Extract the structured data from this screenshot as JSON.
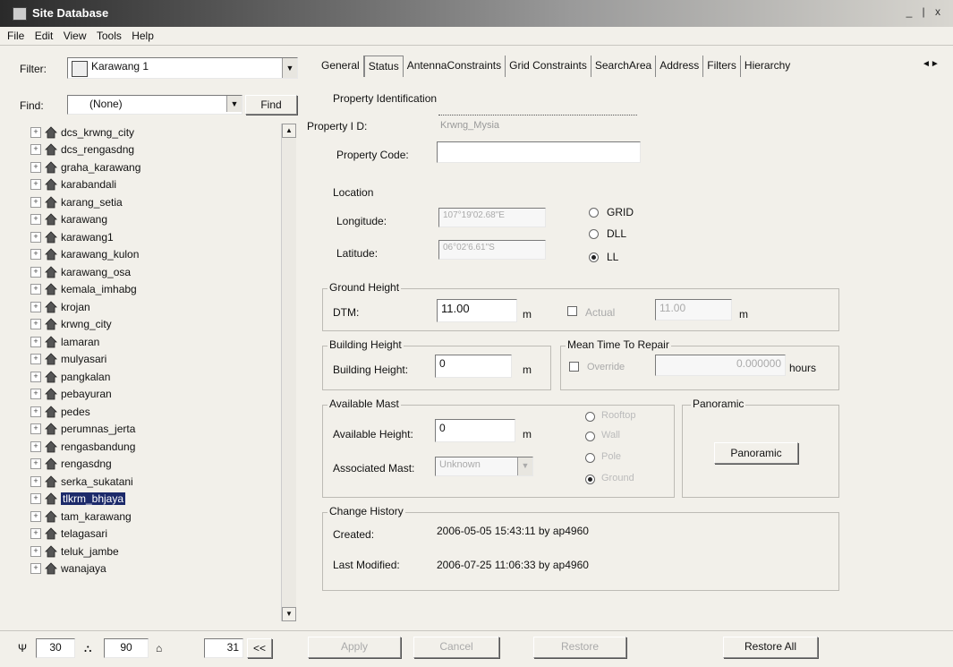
{
  "window": {
    "title": "Site Database"
  },
  "menu": [
    "File",
    "Edit",
    "View",
    "Tools",
    "Help"
  ],
  "left": {
    "filter_label": "Filter:",
    "filter_value": "Karawang 1",
    "find_label": "Find:",
    "find_value": "(None)",
    "find_button": "Find",
    "tree": [
      "dcs_krwng_city",
      "dcs_rengasdng",
      "graha_karawang",
      "karabandali",
      "karang_setia",
      "karawang",
      "karawang1",
      "karawang_kulon",
      "karawang_osa",
      "kemala_imhabg",
      "krojan",
      "krwng_city",
      "lamaran",
      "mulyasari",
      "pangkalan",
      "pebayuran",
      "pedes",
      "perumnas_jerta",
      "rengasbandung",
      "rengasdng",
      "serka_sukatani",
      "tlkrm_bhjaya",
      "tam_karawang",
      "telagasari",
      "teluk_jambe",
      "wanajaya"
    ],
    "selected_index": 21
  },
  "tabs": [
    "General",
    "Status",
    "AntennaConstraints",
    "Grid Constraints",
    "SearchArea",
    "Address",
    "Filters",
    "Hierarchy"
  ],
  "active_tab": 1,
  "property": {
    "group": "Property Identification",
    "id_label": "Property I D:",
    "id_value": "Krwng_Mysia",
    "code_label": "Property Code:",
    "code_value": ""
  },
  "location": {
    "group": "Location",
    "lon_label": "Longitude:",
    "lon_value": "107°19'02.68\"E",
    "lat_label": "Latitude:",
    "lat_value": "06°02'6.61\"S",
    "radio": [
      "GRID",
      "DLL",
      "LL"
    ],
    "selected": 2
  },
  "ground": {
    "group": "Ground Height",
    "dtm_label": "DTM:",
    "dtm_value": "11.00",
    "unit": "m",
    "actual_label": "Actual",
    "actual_value": "11.00",
    "actual_unit": "m"
  },
  "building": {
    "group": "Building Height",
    "label": "Building Height:",
    "value": "0",
    "unit": "m"
  },
  "mttr": {
    "group": "Mean Time To Repair",
    "override_label": "Override",
    "value": "0.000000",
    "unit": "hours"
  },
  "mast": {
    "group": "Available Mast",
    "height_label": "Available Height:",
    "height_value": "0",
    "unit": "m",
    "assoc_label": "Associated Mast:",
    "assoc_value": "Unknown",
    "radio": [
      "Rooftop",
      "Wall",
      "Pole",
      "Ground"
    ],
    "selected": 3
  },
  "panoramic": {
    "group": "Panoramic",
    "button": "Panoramic"
  },
  "history": {
    "group": "Change History",
    "created_label": "Created:",
    "created_value": "2006-05-05 15:43:11 by ap4960",
    "modified_label": "Last Modified:",
    "modified_value": "2006-07-25 11:06:33 by ap4960"
  },
  "statusbar": {
    "count1": "30",
    "count2": "90",
    "count3": "31",
    "collapse": "<<"
  },
  "buttons": {
    "apply": "Apply",
    "cancel": "Cancel",
    "restore": "Restore",
    "restore_all": "Restore All"
  }
}
